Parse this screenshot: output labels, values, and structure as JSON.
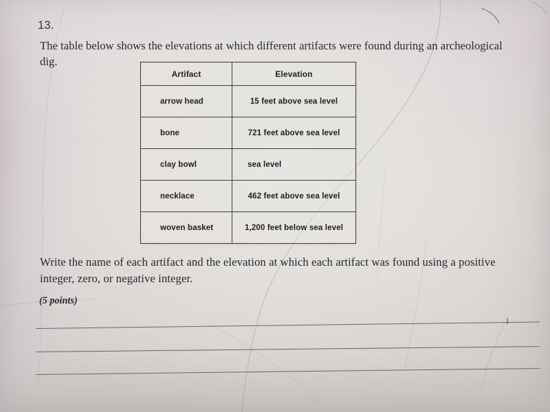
{
  "question": {
    "number": "13.",
    "body": "The table below shows the elevations at which different artifacts were found during an archeological dig.",
    "prompt": "Write the name of each artifact and the elevation at which each artifact was found using a positive integer, zero, or negative integer.",
    "points": "(5 points)"
  },
  "table": {
    "headers": [
      "Artifact",
      "Elevation"
    ],
    "rows": [
      {
        "artifact": "arrow head",
        "elevation": "15 feet above sea level"
      },
      {
        "artifact": "bone",
        "elevation": "721 feet above sea level"
      },
      {
        "artifact": "clay bowl",
        "elevation": "sea level"
      },
      {
        "artifact": "necklace",
        "elevation": "462 feet above sea level"
      },
      {
        "artifact": "woven basket",
        "elevation": "1,200 feet below sea level"
      }
    ]
  },
  "answer_lines": [
    "",
    "",
    ""
  ],
  "colors": {
    "paper": "#e4e1de",
    "ink": "#25252a",
    "table_border": "#3a3a3c",
    "rule_line": "#5d5a59"
  }
}
